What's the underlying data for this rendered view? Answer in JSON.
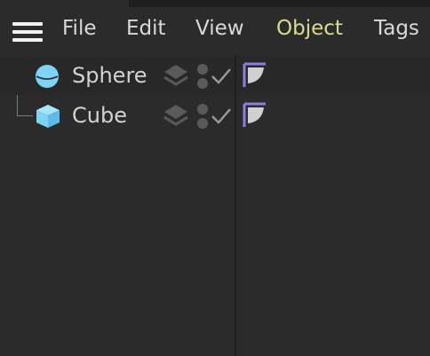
{
  "menu": {
    "items": [
      {
        "label": "File"
      },
      {
        "label": "Edit"
      },
      {
        "label": "View"
      },
      {
        "label": "Object"
      },
      {
        "label": "Tags"
      }
    ],
    "active_color": "#d9dc8c",
    "text_color": "#d9d9d9"
  },
  "objects": [
    {
      "name": "Sphere",
      "icon": "sphere-icon",
      "selected": true
    },
    {
      "name": "Cube",
      "icon": "cube-icon",
      "selected": false
    }
  ],
  "colors": {
    "background": "#2b2b2b",
    "object_icon": "#7fd3f7",
    "tag_accent": "#8b7fe0"
  }
}
